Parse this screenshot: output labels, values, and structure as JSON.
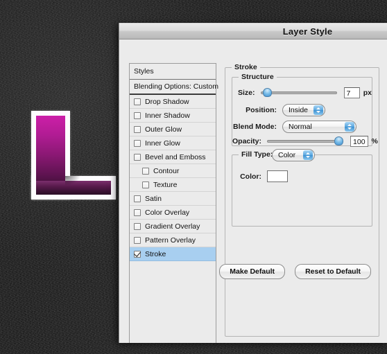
{
  "window": {
    "title": "Layer Style"
  },
  "artwork": {
    "letter": "L",
    "stroke_color": "#fdfcfe",
    "fill_top_color": "#cc1fa8",
    "fill_bottom_color": "#2a0f26"
  },
  "styles_list": {
    "header_label": "Styles",
    "blending_options_label": "Blending Options: Custom",
    "items": [
      {
        "label": "Drop Shadow",
        "checked": false,
        "indent": false,
        "selected": false
      },
      {
        "label": "Inner Shadow",
        "checked": false,
        "indent": false,
        "selected": false
      },
      {
        "label": "Outer Glow",
        "checked": false,
        "indent": false,
        "selected": false
      },
      {
        "label": "Inner Glow",
        "checked": false,
        "indent": false,
        "selected": false
      },
      {
        "label": "Bevel and Emboss",
        "checked": false,
        "indent": false,
        "selected": false
      },
      {
        "label": "Contour",
        "checked": false,
        "indent": true,
        "selected": false
      },
      {
        "label": "Texture",
        "checked": false,
        "indent": true,
        "selected": false
      },
      {
        "label": "Satin",
        "checked": false,
        "indent": false,
        "selected": false
      },
      {
        "label": "Color Overlay",
        "checked": false,
        "indent": false,
        "selected": false
      },
      {
        "label": "Gradient Overlay",
        "checked": false,
        "indent": false,
        "selected": false
      },
      {
        "label": "Pattern Overlay",
        "checked": false,
        "indent": false,
        "selected": false
      },
      {
        "label": "Stroke",
        "checked": true,
        "indent": false,
        "selected": true
      }
    ],
    "selection_color": "#a8cff0"
  },
  "stroke_panel": {
    "group_label": "Stroke",
    "structure": {
      "group_label": "Structure",
      "size": {
        "label": "Size:",
        "value": "7",
        "unit": "px",
        "slider_percent": 4
      },
      "position": {
        "label": "Position:",
        "value": "Inside"
      },
      "blend_mode": {
        "label": "Blend Mode:",
        "value": "Normal"
      },
      "opacity": {
        "label": "Opacity:",
        "value": "100",
        "unit": "%",
        "slider_percent": 100
      }
    },
    "fill": {
      "type_label": "Fill Type:",
      "type_value": "Color",
      "color_label": "Color:",
      "color_value": "#ffffff"
    }
  },
  "buttons": {
    "make_default": "Make Default",
    "reset_to_default": "Reset to Default"
  }
}
